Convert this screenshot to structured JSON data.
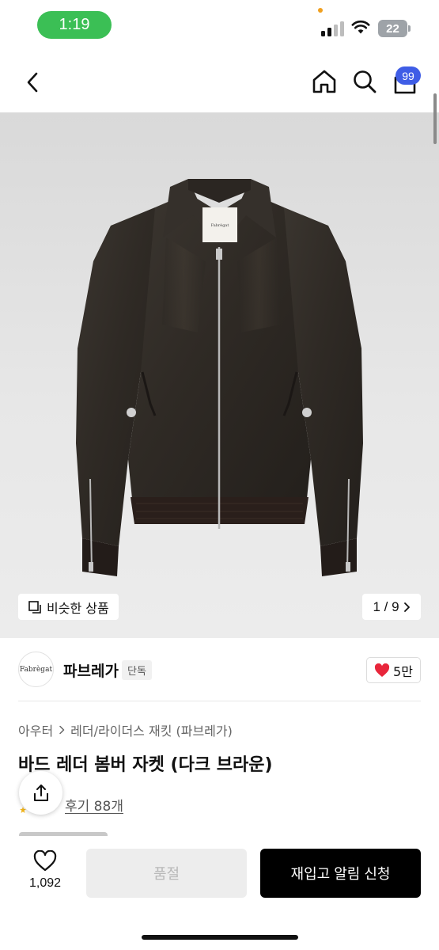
{
  "status_bar": {
    "time": "1:19",
    "battery": "22"
  },
  "header": {
    "cart_count": "99"
  },
  "gallery": {
    "label_tag": "Fabrègat",
    "similar_label": "비슷한 상품",
    "page_indicator": "1 / 9"
  },
  "brand": {
    "logo_text": "Fabrègat",
    "name": "파브레가",
    "badge": "단독",
    "likes": "5만"
  },
  "product": {
    "breadcrumb": [
      "아우터",
      "레더/라이더스 재킷 (파브레가)"
    ],
    "title": "바드 레더 봄버 자켓 (다크 브라운)",
    "review_link": "후기 88개"
  },
  "bottom_bar": {
    "wish_count": "1,092",
    "soldout_label": "품절",
    "restock_label": "재입고 알림 신청"
  },
  "icons": {
    "back": "chevron-left-icon",
    "home": "home-icon",
    "search": "search-icon",
    "cart": "cart-icon",
    "similar": "copy-icon",
    "next": "chevron-right-icon",
    "like": "heart-filled-icon",
    "share": "share-icon",
    "wish": "heart-outline-icon"
  },
  "colors": {
    "status_pill": "#3bbf55",
    "cart_badge": "#3f5de6",
    "like_heart": "#e8263b",
    "restock_button": "#000000",
    "soldout_button": "#ededed"
  }
}
